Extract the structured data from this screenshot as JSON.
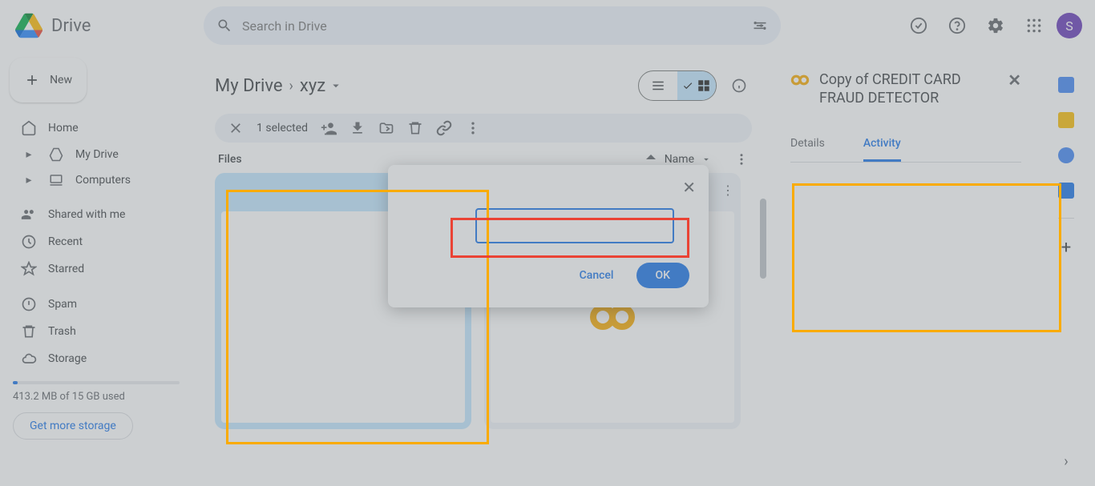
{
  "header": {
    "app_title": "Drive",
    "search_placeholder": "Search in Drive",
    "avatar_initial": "S"
  },
  "sidebar": {
    "new_label": "New",
    "items": [
      {
        "label": "Home"
      },
      {
        "label": "My Drive"
      },
      {
        "label": "Computers"
      },
      {
        "label": "Shared with me"
      },
      {
        "label": "Recent"
      },
      {
        "label": "Starred"
      },
      {
        "label": "Spam"
      },
      {
        "label": "Trash"
      },
      {
        "label": "Storage"
      }
    ],
    "storage_used": "413.2 MB of 15 GB used",
    "storage_btn": "Get more storage"
  },
  "content": {
    "breadcrumb_root": "My Drive",
    "breadcrumb_current": "xyz",
    "selected_text": "1 selected",
    "files_heading": "Files",
    "sort_label": "Name"
  },
  "side_panel": {
    "title": "Copy of CREDIT CARD FRAUD DETECTOR",
    "tab_details": "Details",
    "tab_activity": "Activity"
  },
  "dialog": {
    "input_value": "",
    "cancel_label": "Cancel",
    "ok_label": "OK"
  }
}
